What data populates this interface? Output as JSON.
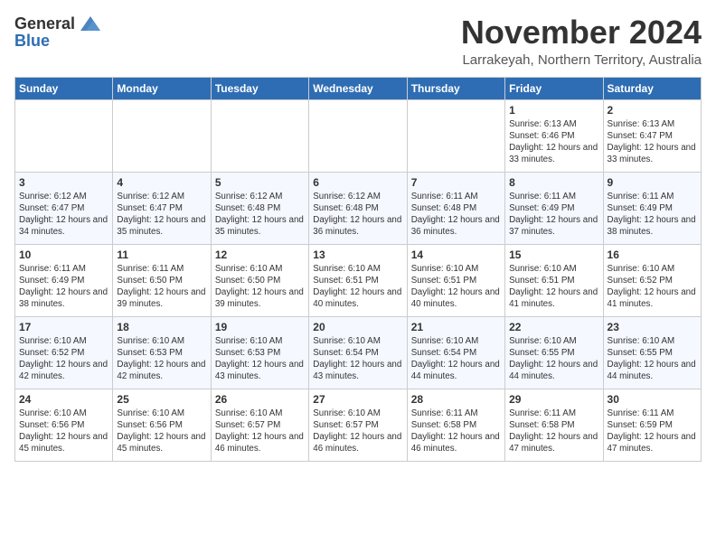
{
  "header": {
    "logo_general": "General",
    "logo_blue": "Blue",
    "month_title": "November 2024",
    "subtitle": "Larrakeyah, Northern Territory, Australia"
  },
  "weekdays": [
    "Sunday",
    "Monday",
    "Tuesday",
    "Wednesday",
    "Thursday",
    "Friday",
    "Saturday"
  ],
  "weeks": [
    [
      {
        "day": "",
        "info": ""
      },
      {
        "day": "",
        "info": ""
      },
      {
        "day": "",
        "info": ""
      },
      {
        "day": "",
        "info": ""
      },
      {
        "day": "",
        "info": ""
      },
      {
        "day": "1",
        "info": "Sunrise: 6:13 AM\nSunset: 6:46 PM\nDaylight: 12 hours and 33 minutes."
      },
      {
        "day": "2",
        "info": "Sunrise: 6:13 AM\nSunset: 6:47 PM\nDaylight: 12 hours and 33 minutes."
      }
    ],
    [
      {
        "day": "3",
        "info": "Sunrise: 6:12 AM\nSunset: 6:47 PM\nDaylight: 12 hours and 34 minutes."
      },
      {
        "day": "4",
        "info": "Sunrise: 6:12 AM\nSunset: 6:47 PM\nDaylight: 12 hours and 35 minutes."
      },
      {
        "day": "5",
        "info": "Sunrise: 6:12 AM\nSunset: 6:48 PM\nDaylight: 12 hours and 35 minutes."
      },
      {
        "day": "6",
        "info": "Sunrise: 6:12 AM\nSunset: 6:48 PM\nDaylight: 12 hours and 36 minutes."
      },
      {
        "day": "7",
        "info": "Sunrise: 6:11 AM\nSunset: 6:48 PM\nDaylight: 12 hours and 36 minutes."
      },
      {
        "day": "8",
        "info": "Sunrise: 6:11 AM\nSunset: 6:49 PM\nDaylight: 12 hours and 37 minutes."
      },
      {
        "day": "9",
        "info": "Sunrise: 6:11 AM\nSunset: 6:49 PM\nDaylight: 12 hours and 38 minutes."
      }
    ],
    [
      {
        "day": "10",
        "info": "Sunrise: 6:11 AM\nSunset: 6:49 PM\nDaylight: 12 hours and 38 minutes."
      },
      {
        "day": "11",
        "info": "Sunrise: 6:11 AM\nSunset: 6:50 PM\nDaylight: 12 hours and 39 minutes."
      },
      {
        "day": "12",
        "info": "Sunrise: 6:10 AM\nSunset: 6:50 PM\nDaylight: 12 hours and 39 minutes."
      },
      {
        "day": "13",
        "info": "Sunrise: 6:10 AM\nSunset: 6:51 PM\nDaylight: 12 hours and 40 minutes."
      },
      {
        "day": "14",
        "info": "Sunrise: 6:10 AM\nSunset: 6:51 PM\nDaylight: 12 hours and 40 minutes."
      },
      {
        "day": "15",
        "info": "Sunrise: 6:10 AM\nSunset: 6:51 PM\nDaylight: 12 hours and 41 minutes."
      },
      {
        "day": "16",
        "info": "Sunrise: 6:10 AM\nSunset: 6:52 PM\nDaylight: 12 hours and 41 minutes."
      }
    ],
    [
      {
        "day": "17",
        "info": "Sunrise: 6:10 AM\nSunset: 6:52 PM\nDaylight: 12 hours and 42 minutes."
      },
      {
        "day": "18",
        "info": "Sunrise: 6:10 AM\nSunset: 6:53 PM\nDaylight: 12 hours and 42 minutes."
      },
      {
        "day": "19",
        "info": "Sunrise: 6:10 AM\nSunset: 6:53 PM\nDaylight: 12 hours and 43 minutes."
      },
      {
        "day": "20",
        "info": "Sunrise: 6:10 AM\nSunset: 6:54 PM\nDaylight: 12 hours and 43 minutes."
      },
      {
        "day": "21",
        "info": "Sunrise: 6:10 AM\nSunset: 6:54 PM\nDaylight: 12 hours and 44 minutes."
      },
      {
        "day": "22",
        "info": "Sunrise: 6:10 AM\nSunset: 6:55 PM\nDaylight: 12 hours and 44 minutes."
      },
      {
        "day": "23",
        "info": "Sunrise: 6:10 AM\nSunset: 6:55 PM\nDaylight: 12 hours and 44 minutes."
      }
    ],
    [
      {
        "day": "24",
        "info": "Sunrise: 6:10 AM\nSunset: 6:56 PM\nDaylight: 12 hours and 45 minutes."
      },
      {
        "day": "25",
        "info": "Sunrise: 6:10 AM\nSunset: 6:56 PM\nDaylight: 12 hours and 45 minutes."
      },
      {
        "day": "26",
        "info": "Sunrise: 6:10 AM\nSunset: 6:57 PM\nDaylight: 12 hours and 46 minutes."
      },
      {
        "day": "27",
        "info": "Sunrise: 6:10 AM\nSunset: 6:57 PM\nDaylight: 12 hours and 46 minutes."
      },
      {
        "day": "28",
        "info": "Sunrise: 6:11 AM\nSunset: 6:58 PM\nDaylight: 12 hours and 46 minutes."
      },
      {
        "day": "29",
        "info": "Sunrise: 6:11 AM\nSunset: 6:58 PM\nDaylight: 12 hours and 47 minutes."
      },
      {
        "day": "30",
        "info": "Sunrise: 6:11 AM\nSunset: 6:59 PM\nDaylight: 12 hours and 47 minutes."
      }
    ]
  ]
}
